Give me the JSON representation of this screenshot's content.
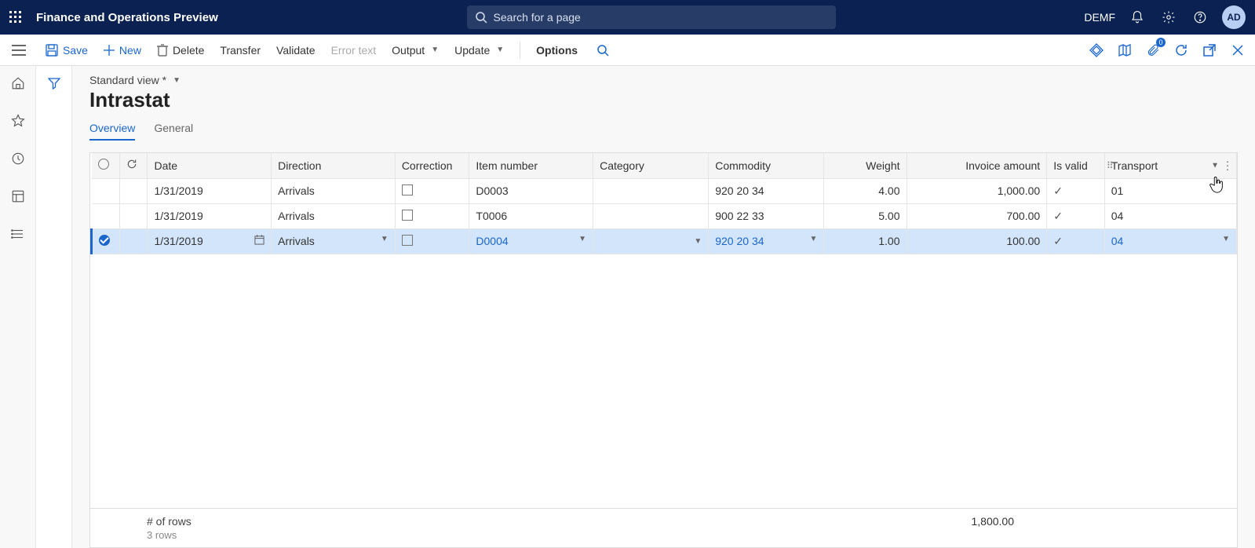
{
  "app": {
    "title": "Finance and Operations Preview"
  },
  "search": {
    "placeholder": "Search for a page"
  },
  "company": "DEMF",
  "avatar": "AD",
  "attachments_count": "0",
  "commands": {
    "save": "Save",
    "new": "New",
    "delete": "Delete",
    "transfer": "Transfer",
    "validate": "Validate",
    "error_text": "Error text",
    "output": "Output",
    "update": "Update",
    "options": "Options"
  },
  "page": {
    "view_label": "Standard view *",
    "title": "Intrastat",
    "tabs": {
      "overview": "Overview",
      "general": "General"
    }
  },
  "columns": {
    "date": "Date",
    "direction": "Direction",
    "correction": "Correction",
    "item_number": "Item number",
    "category": "Category",
    "commodity": "Commodity",
    "weight": "Weight",
    "invoice_amount": "Invoice amount",
    "is_valid": "Is valid",
    "transport": "Transport"
  },
  "rows": [
    {
      "date": "1/31/2019",
      "direction": "Arrivals",
      "item": "D0003",
      "category": "",
      "commodity": "920 20 34",
      "weight": "4.00",
      "invoice": "1,000.00",
      "valid": true,
      "transport": "01"
    },
    {
      "date": "1/31/2019",
      "direction": "Arrivals",
      "item": "T0006",
      "category": "",
      "commodity": "900 22 33",
      "weight": "5.00",
      "invoice": "700.00",
      "valid": true,
      "transport": "04"
    },
    {
      "date": "1/31/2019",
      "direction": "Arrivals",
      "item": "D0004",
      "category": "",
      "commodity": "920 20 34",
      "weight": "1.00",
      "invoice": "100.00",
      "valid": true,
      "transport": "04"
    }
  ],
  "footer": {
    "rows_label": "# of rows",
    "rows_count": "3 rows",
    "total_invoice": "1,800.00"
  }
}
